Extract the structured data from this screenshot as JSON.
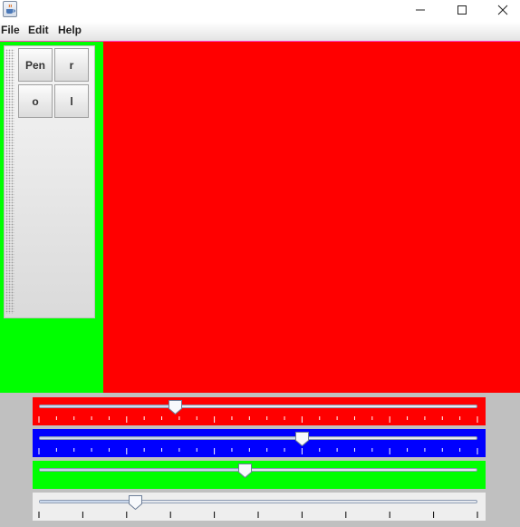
{
  "window": {
    "app_icon": "java-cup-icon",
    "controls": [
      "minimize-icon",
      "maximize-icon",
      "close-icon"
    ]
  },
  "menu": {
    "items": [
      {
        "label": "File"
      },
      {
        "label": "Edit"
      },
      {
        "label": "Help"
      }
    ]
  },
  "toolbar": {
    "buttons": [
      {
        "label": "Pen"
      },
      {
        "label": "r"
      },
      {
        "label": "o"
      },
      {
        "label": "l"
      }
    ]
  },
  "colors": {
    "canvas": "#ff0000",
    "left_panel": "#00ff00",
    "bottom_panel": "#c0c0c0"
  },
  "sliders": [
    {
      "name": "red-slider",
      "background": "#ff0000",
      "value_fraction": 0.31,
      "ticks": 25,
      "major_every": 5,
      "tick_color": "#ffffff"
    },
    {
      "name": "blue-slider",
      "background": "#0000ff",
      "value_fraction": 0.6,
      "ticks": 25,
      "major_every": 5,
      "tick_color": "#ffffff"
    },
    {
      "name": "green-slider",
      "background": "#00ff00",
      "value_fraction": 0.47,
      "ticks": 0,
      "major_every": 0,
      "tick_color": "#000000"
    },
    {
      "name": "gray-slider",
      "background": "#eeeeee",
      "value_fraction": 0.22,
      "ticks": 10,
      "major_every": 1,
      "tick_color": "#000000"
    }
  ]
}
